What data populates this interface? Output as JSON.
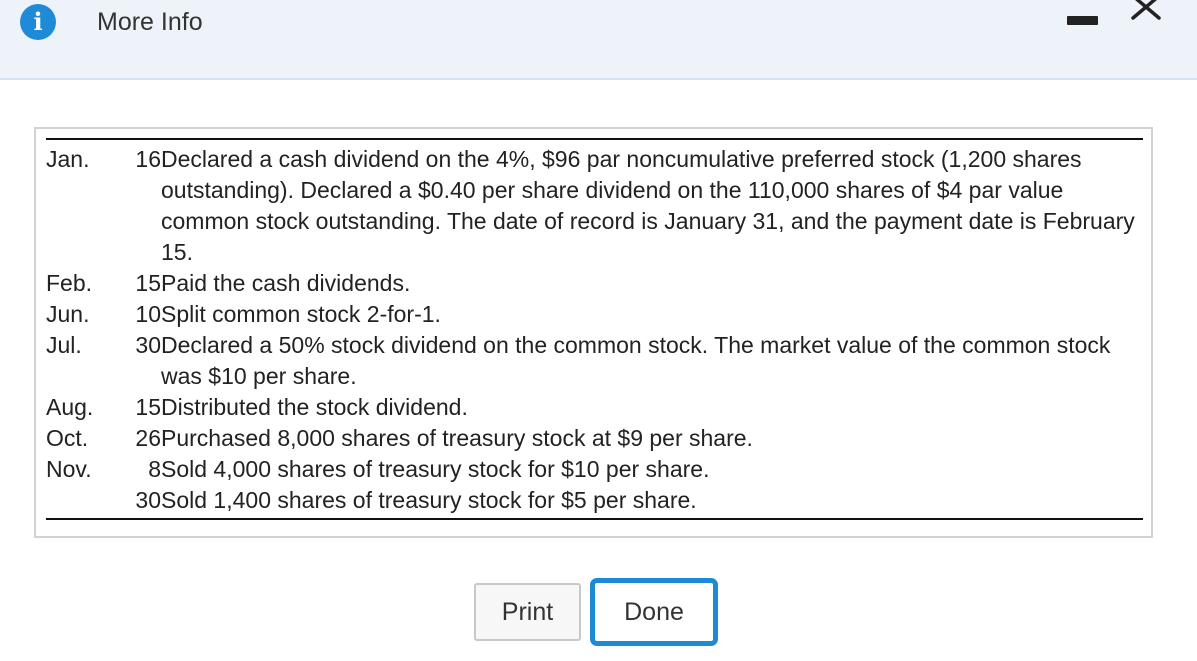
{
  "dialog": {
    "title": "More Info",
    "info_icon_glyph": "i",
    "colors": {
      "header_bg": "#eef3fa",
      "accent": "#1f8ad8"
    }
  },
  "events": [
    {
      "month": "Jan.",
      "day": "16",
      "text": "Declared a cash dividend on the 4%, $96 par noncumulative preferred stock (1,200 shares outstanding). Declared a $0.40 per share dividend on the 110,000 shares of $4 par value common stock outstanding. The date of record is January 31, and the payment date is February 15."
    },
    {
      "month": "Feb.",
      "day": "15",
      "text": "Paid the cash dividends."
    },
    {
      "month": "Jun.",
      "day": "10",
      "text": "Split common stock 2-for-1."
    },
    {
      "month": "Jul.",
      "day": "30",
      "text": "Declared a 50% stock dividend on the common stock. The market value of the common stock was $10 per share."
    },
    {
      "month": "Aug.",
      "day": "15",
      "text": "Distributed the stock dividend."
    },
    {
      "month": "Oct.",
      "day": "26",
      "text": "Purchased 8,000 shares of treasury stock at $9 per share."
    },
    {
      "month": "Nov.",
      "day": "8",
      "text": "Sold 4,000 shares of treasury stock for $10 per share."
    },
    {
      "month": "",
      "day": "30",
      "text": "Sold 1,400 shares of treasury stock for $5 per share."
    }
  ],
  "buttons": {
    "print_label": "Print",
    "done_label": "Done"
  }
}
